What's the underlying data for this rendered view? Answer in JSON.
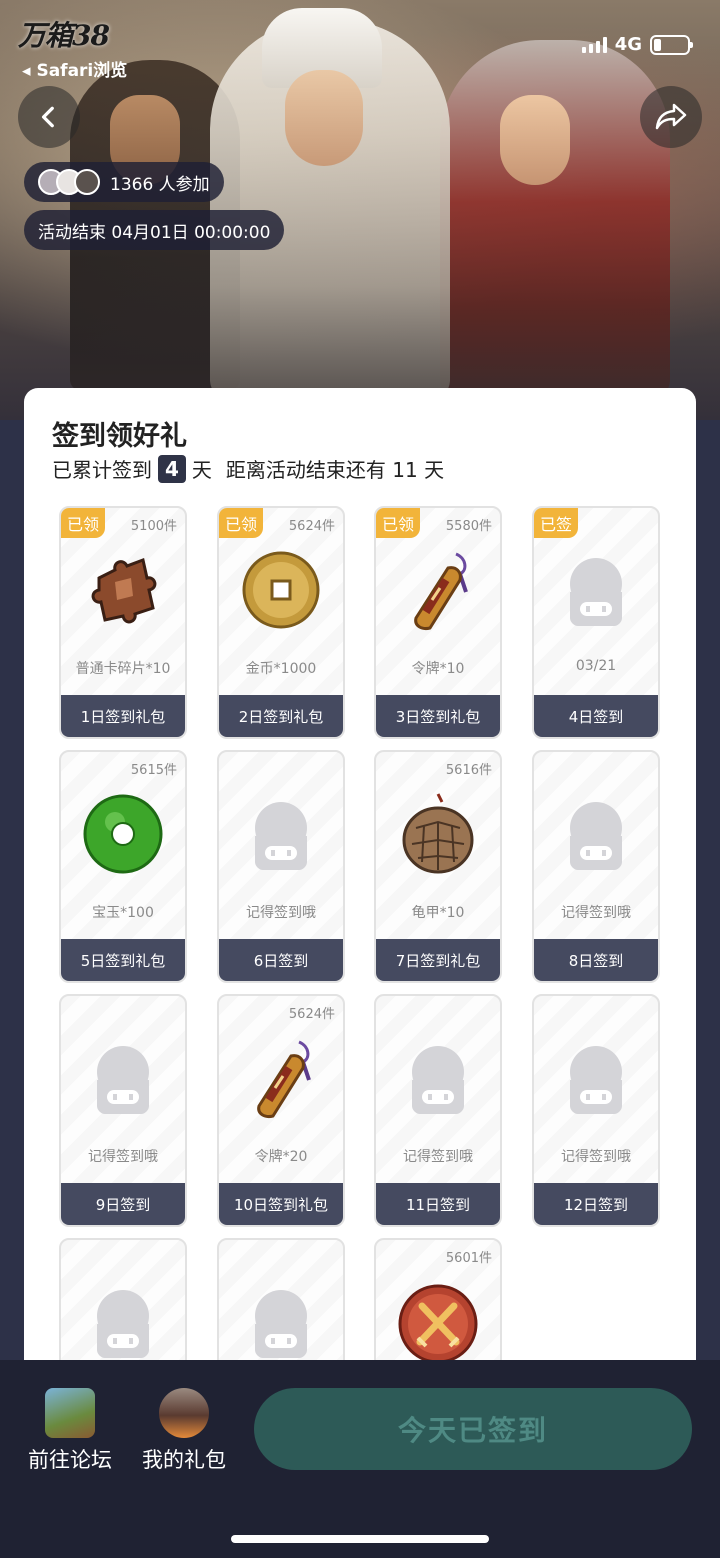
{
  "status_bar": {
    "app_logo": "万箱38",
    "back_app": "Safari浏览",
    "network": "4G",
    "battery_level": 0.22
  },
  "event": {
    "participants": "1366 人参加",
    "end_time": "活动结束 04月01日 00:00:00"
  },
  "checkin": {
    "title": "签到领好礼",
    "summary_prefix": "已累计签到",
    "days_signed": "4",
    "summary_unit": "天",
    "remaining": "距离活动结束还有 11 天"
  },
  "tiles": [
    {
      "tag": "已领",
      "count": "5100件",
      "name": "普通卡碎片*10",
      "footer": "1日签到礼包",
      "icon": "puzzle-icon"
    },
    {
      "tag": "已领",
      "count": "5624件",
      "name": "金币*1000",
      "footer": "2日签到礼包",
      "icon": "coin-icon"
    },
    {
      "tag": "已领",
      "count": "5580件",
      "name": "令牌*10",
      "footer": "3日签到礼包",
      "icon": "token-icon"
    },
    {
      "tag": "已签",
      "count": "",
      "name": "03/21",
      "footer": "4日签到",
      "icon": "placeholder-icon"
    },
    {
      "tag": "",
      "count": "5615件",
      "name": "宝玉*100",
      "footer": "5日签到礼包",
      "icon": "jade-icon"
    },
    {
      "tag": "",
      "count": "",
      "name": "记得签到哦",
      "footer": "6日签到",
      "icon": "placeholder-icon"
    },
    {
      "tag": "",
      "count": "5616件",
      "name": "龟甲*10",
      "footer": "7日签到礼包",
      "icon": "shell-icon"
    },
    {
      "tag": "",
      "count": "",
      "name": "记得签到哦",
      "footer": "8日签到",
      "icon": "placeholder-icon"
    },
    {
      "tag": "",
      "count": "",
      "name": "记得签到哦",
      "footer": "9日签到",
      "icon": "placeholder-icon"
    },
    {
      "tag": "",
      "count": "5624件",
      "name": "令牌*20",
      "footer": "10日签到礼包",
      "icon": "token-icon"
    },
    {
      "tag": "",
      "count": "",
      "name": "记得签到哦",
      "footer": "11日签到",
      "icon": "placeholder-icon"
    },
    {
      "tag": "",
      "count": "",
      "name": "记得签到哦",
      "footer": "12日签到",
      "icon": "placeholder-icon"
    },
    {
      "tag": "",
      "count": "",
      "name": "",
      "footer": "",
      "icon": "placeholder-icon"
    },
    {
      "tag": "",
      "count": "",
      "name": "",
      "footer": "",
      "icon": "placeholder-icon"
    },
    {
      "tag": "",
      "count": "5601件",
      "name": "",
      "footer": "",
      "icon": "swords-badge-icon"
    }
  ],
  "bottom_bar": {
    "forum_label": "前往论坛",
    "gifts_label": "我的礼包",
    "signed_label": "今天已签到"
  },
  "colors": {
    "tag": "#f2b43a",
    "tile_footer": "#454a60",
    "signed_button": "#2d5a57"
  }
}
